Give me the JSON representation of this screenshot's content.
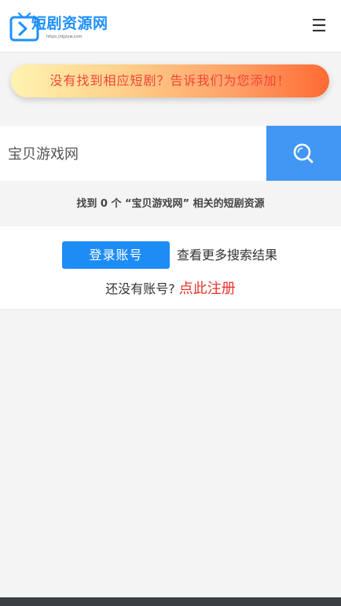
{
  "header": {
    "logo_text": "短剧资源网",
    "logo_subtext": "https://djjzyw.com",
    "menu_icon": "hamburger-menu-icon",
    "brand_color": "#1e90ff"
  },
  "request_banner": {
    "text": "没有找到相应短剧？告诉我们为您添加！"
  },
  "search": {
    "value": "宝贝游戏网",
    "button_icon": "search-icon",
    "button_color": "#4197f3"
  },
  "result_summary": {
    "text": "找到 0 个 “宝贝游戏网” 相关的短剧资源"
  },
  "result_panel": {
    "login_label": "登录账号",
    "more_results_text": "查看更多搜索结果",
    "no_account_text": "还没有账号?",
    "register_label": "点此注册"
  }
}
